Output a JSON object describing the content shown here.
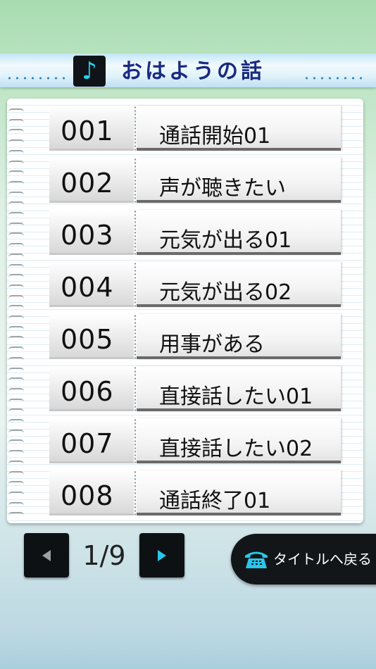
{
  "header": {
    "icon": "music-note-icon",
    "title": "おはようの話"
  },
  "list": {
    "items": [
      {
        "number": "001",
        "name": "通話開始01"
      },
      {
        "number": "002",
        "name": "声が聴きたい"
      },
      {
        "number": "003",
        "name": "元気が出る01"
      },
      {
        "number": "004",
        "name": "元気が出る02"
      },
      {
        "number": "005",
        "name": "用事がある"
      },
      {
        "number": "006",
        "name": "直接話したい01"
      },
      {
        "number": "007",
        "name": "直接話したい02"
      },
      {
        "number": "008",
        "name": "通話終了01"
      }
    ]
  },
  "pagination": {
    "prev_icon": "triangle-left-icon",
    "next_icon": "triangle-right-icon",
    "indicator": "1/9"
  },
  "back_button": {
    "icon": "phone-icon",
    "label": "タイトルへ戻る"
  },
  "colors": {
    "accent": "#29c6ec",
    "title": "#1a2a80",
    "button_bg": "#0d1114"
  }
}
